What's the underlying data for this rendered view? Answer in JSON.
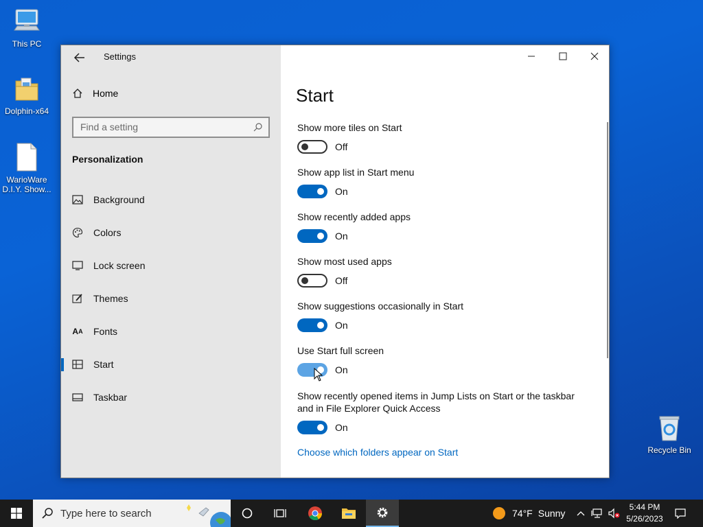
{
  "desktop": {
    "icons": [
      {
        "label": "This PC"
      },
      {
        "label": "Dolphin-x64"
      },
      {
        "label": "WarioWare D.I.Y. Show..."
      },
      {
        "label": "Recycle Bin"
      }
    ]
  },
  "window": {
    "app_title": "Settings",
    "nav": {
      "home_label": "Home",
      "search_placeholder": "Find a setting",
      "section_title": "Personalization",
      "items": [
        {
          "label": "Background",
          "icon": "image-icon"
        },
        {
          "label": "Colors",
          "icon": "palette-icon"
        },
        {
          "label": "Lock screen",
          "icon": "monitor-icon"
        },
        {
          "label": "Themes",
          "icon": "brush-icon"
        },
        {
          "label": "Fonts",
          "icon": "font-icon"
        },
        {
          "label": "Start",
          "icon": "start-layout-icon",
          "selected": true
        },
        {
          "label": "Taskbar",
          "icon": "taskbar-icon"
        }
      ]
    },
    "content": {
      "page_title": "Start",
      "settings": [
        {
          "label": "Show more tiles on Start",
          "state": "Off"
        },
        {
          "label": "Show app list in Start menu",
          "state": "On"
        },
        {
          "label": "Show recently added apps",
          "state": "On"
        },
        {
          "label": "Show most used apps",
          "state": "Off"
        },
        {
          "label": "Show suggestions occasionally in Start",
          "state": "On"
        },
        {
          "label": "Use Start full screen",
          "state": "On"
        },
        {
          "label_line1": "Show recently opened items in Jump Lists on Start or the taskbar",
          "label_line2": "and in File Explorer Quick Access",
          "state": "On"
        }
      ],
      "link": "Choose which folders appear on Start"
    }
  },
  "taskbar": {
    "search_placeholder": "Type here to search",
    "weather": {
      "temp": "74°F",
      "condition": "Sunny"
    },
    "clock": {
      "time": "5:44 PM",
      "date": "5/26/2023"
    }
  },
  "colors": {
    "accent": "#0067c0",
    "toggle_hover": "#5ca4e4",
    "nav_bg": "#e6e6e6",
    "taskbar_bg": "#1b1b1b"
  }
}
